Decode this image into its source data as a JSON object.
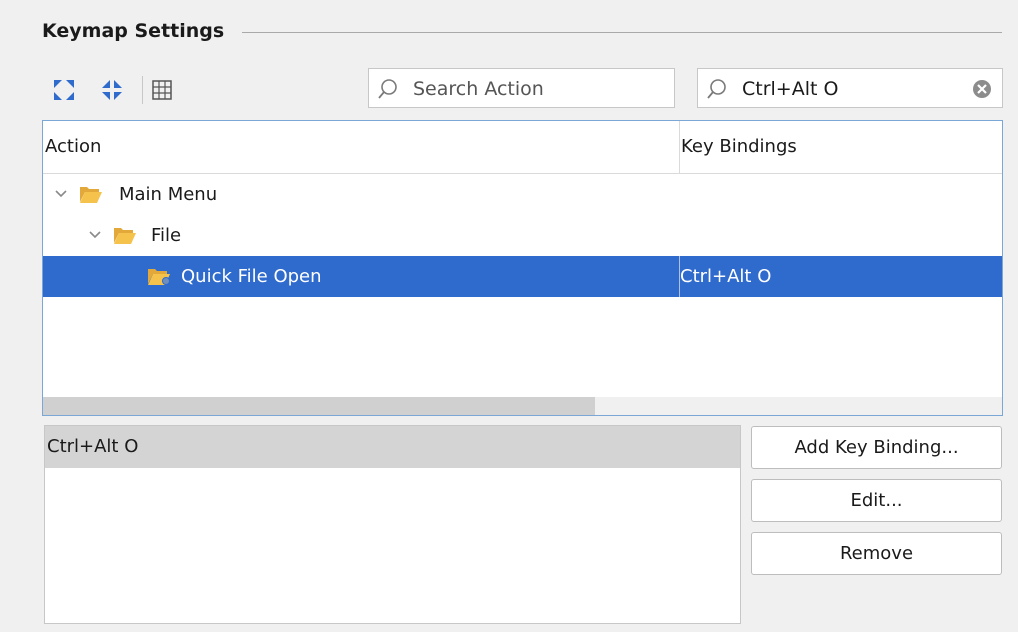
{
  "group": {
    "title": "Keymap Settings"
  },
  "toolbar": {
    "expand_icon": "expand-all-icon",
    "collapse_icon": "collapse-all-icon",
    "grid_icon": "table-icon"
  },
  "search_action": {
    "placeholder": "Search Action",
    "value": ""
  },
  "search_binding": {
    "value": "Ctrl+Alt O"
  },
  "tree": {
    "columns": [
      "Action",
      "Key Bindings"
    ],
    "rows": [
      {
        "label": "Main Menu",
        "binding": "",
        "expanded": true,
        "selected": false
      },
      {
        "label": "File",
        "binding": "",
        "expanded": true,
        "selected": false
      },
      {
        "label": "Quick File Open",
        "binding": "Ctrl+Alt O",
        "selected": true
      }
    ]
  },
  "bindings_list": {
    "items": [
      "Ctrl+Alt O"
    ]
  },
  "buttons": {
    "add": "Add Key Binding...",
    "edit": "Edit...",
    "remove": "Remove"
  },
  "colors": {
    "selection": "#2f6acd",
    "folder": "#f5c24c",
    "border": "#7aa7d6"
  }
}
